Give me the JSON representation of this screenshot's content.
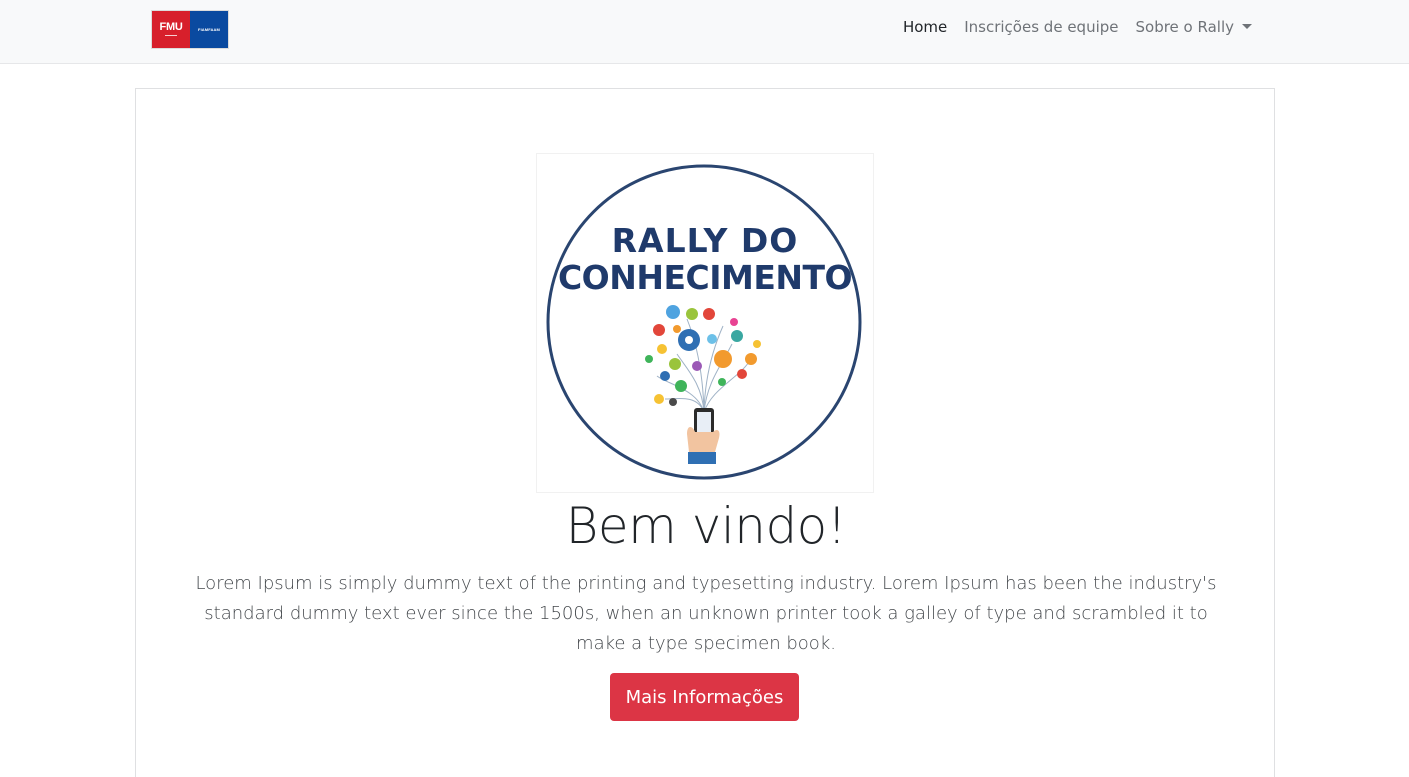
{
  "navbar": {
    "brand": {
      "left_text": "FMU",
      "right_text": "FIAMFAAM"
    },
    "links": [
      {
        "label": "Home",
        "active": true
      },
      {
        "label": "Inscrições de equipe",
        "active": false
      },
      {
        "label": "Sobre o Rally",
        "active": false,
        "dropdown": true
      }
    ]
  },
  "hero": {
    "logo": {
      "line1": "RALLY DO",
      "line2": "CONHECIMENTO"
    },
    "title": "Bem vindo!",
    "lead": "Lorem Ipsum is simply dummy text of the printing and typesetting industry. Lorem Ipsum has been the industry's standard dummy text ever since the 1500s, when an unknown printer took a galley of type and scrambled it to make a type specimen book.",
    "button_label": "Mais Informações"
  },
  "colors": {
    "navbar_bg": "#f8f9fa",
    "button": "#dc3545",
    "logo_text": "#1f3a6b",
    "brand_red": "#d71f2b",
    "brand_blue": "#0a4aa0"
  }
}
